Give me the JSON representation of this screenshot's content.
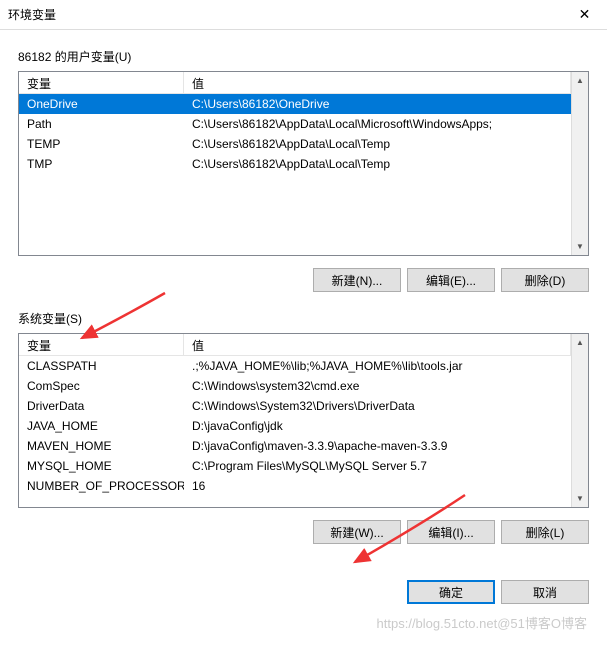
{
  "titlebar": {
    "title": "环境变量",
    "close": "✕"
  },
  "user_section": {
    "label": "86182 的用户变量(U)",
    "headers": {
      "name": "变量",
      "value": "值"
    },
    "rows": [
      {
        "name": "OneDrive",
        "value": "C:\\Users\\86182\\OneDrive",
        "selected": true
      },
      {
        "name": "Path",
        "value": "C:\\Users\\86182\\AppData\\Local\\Microsoft\\WindowsApps;"
      },
      {
        "name": "TEMP",
        "value": "C:\\Users\\86182\\AppData\\Local\\Temp"
      },
      {
        "name": "TMP",
        "value": "C:\\Users\\86182\\AppData\\Local\\Temp"
      }
    ],
    "buttons": {
      "new": "新建(N)...",
      "edit": "编辑(E)...",
      "delete": "删除(D)"
    }
  },
  "system_section": {
    "label": "系统变量(S)",
    "headers": {
      "name": "变量",
      "value": "值"
    },
    "rows": [
      {
        "name": "CLASSPATH",
        "value": ".;%JAVA_HOME%\\lib;%JAVA_HOME%\\lib\\tools.jar"
      },
      {
        "name": "ComSpec",
        "value": "C:\\Windows\\system32\\cmd.exe"
      },
      {
        "name": "DriverData",
        "value": "C:\\Windows\\System32\\Drivers\\DriverData"
      },
      {
        "name": "JAVA_HOME",
        "value": "D:\\javaConfig\\jdk"
      },
      {
        "name": "MAVEN_HOME",
        "value": "D:\\javaConfig\\maven-3.3.9\\apache-maven-3.3.9"
      },
      {
        "name": "MYSQL_HOME",
        "value": "C:\\Program Files\\MySQL\\MySQL Server 5.7"
      },
      {
        "name": "NUMBER_OF_PROCESSORS",
        "value": "16"
      }
    ],
    "buttons": {
      "new": "新建(W)...",
      "edit": "编辑(I)...",
      "delete": "删除(L)"
    }
  },
  "footer": {
    "ok": "确定",
    "cancel": "取消"
  },
  "watermark": "https://blog.51cto.net@51博客O博客"
}
